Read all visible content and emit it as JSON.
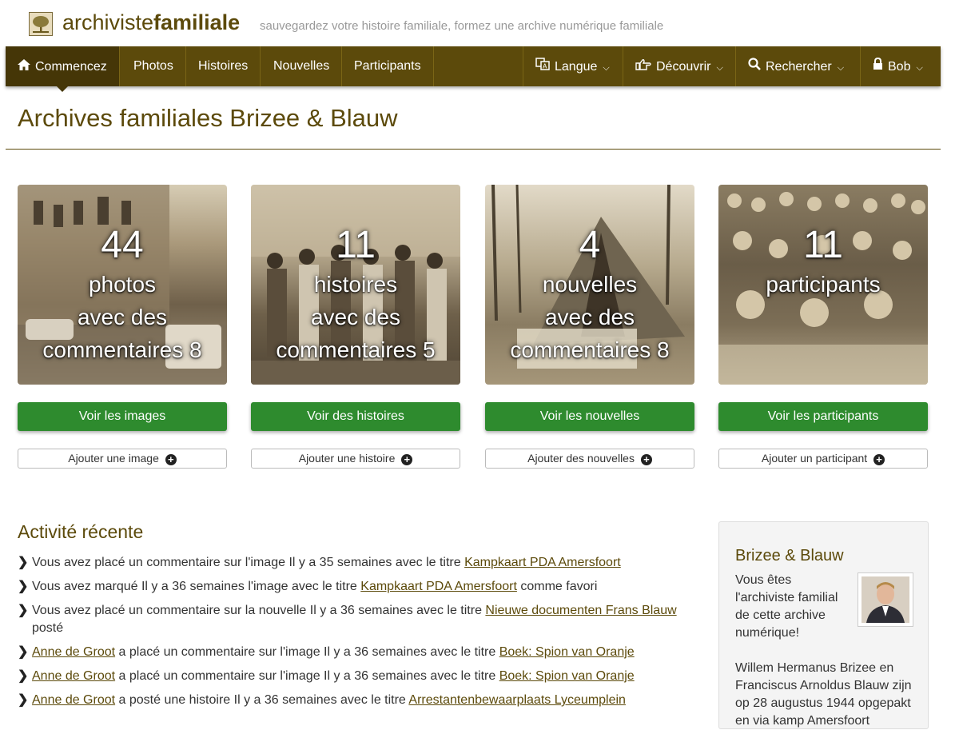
{
  "brand": {
    "name_light": "archiviste",
    "name_bold": "familiale",
    "tagline": "sauvegardez votre histoire familiale, formez une archive numérique familiale",
    "logo_icon": "tree-logo-icon"
  },
  "nav": {
    "items": [
      {
        "label": "Commencez",
        "icon": "home-icon",
        "active": true
      },
      {
        "label": "Photos"
      },
      {
        "label": "Histoires"
      },
      {
        "label": "Nouvelles"
      },
      {
        "label": "Participants"
      }
    ],
    "right": [
      {
        "label": "Langue",
        "icon": "translate-icon"
      },
      {
        "label": "Découvrir",
        "icon": "pointing-hand-icon"
      },
      {
        "label": "Rechercher",
        "icon": "search-icon"
      },
      {
        "label": "Bob",
        "icon": "lock-icon"
      }
    ]
  },
  "page_title": "Archives familiales Brizee & Blauw",
  "cards": [
    {
      "count": "44",
      "line1": "photos",
      "line2": "avec des",
      "line3": "commentaires 8",
      "view_label": "Voir les images",
      "add_label": "Ajouter une image"
    },
    {
      "count": "11",
      "line1": "histoires",
      "line2": "avec des",
      "line3": "commentaires 5",
      "view_label": "Voir des histoires",
      "add_label": "Ajouter une histoire"
    },
    {
      "count": "4",
      "line1": "nouvelles",
      "line2": "avec des",
      "line3": "commentaires 8",
      "view_label": "Voir les nouvelles",
      "add_label": "Ajouter des nouvelles"
    },
    {
      "count": "11",
      "line1": "participants",
      "line2": "",
      "line3": "",
      "view_label": "Voir les participants",
      "add_label": "Ajouter un participant"
    }
  ],
  "activity": {
    "title": "Activité récente",
    "items": [
      {
        "pre_link": "",
        "pre": "Vous avez placé un commentaire sur l'image Il y a 35 semaines avec le titre ",
        "link": "Kampkaart PDA Amersfoort",
        "post": ""
      },
      {
        "pre_link": "",
        "pre": "Vous avez marqué Il y a 36 semaines l'image avec le titre ",
        "link": "Kampkaart PDA Amersfoort",
        "post": " comme favori"
      },
      {
        "pre_link": "",
        "pre": "Vous avez placé un commentaire sur la nouvelle Il y a 36 semaines avec le titre ",
        "link": "Nieuwe documenten Frans Blauw",
        "post": " posté"
      },
      {
        "pre_link": "Anne de Groot",
        "pre": " a placé un commentaire sur l'image Il y a 36 semaines avec le titre ",
        "link": "Boek: Spion van Oranje",
        "post": ""
      },
      {
        "pre_link": "Anne de Groot",
        "pre": " a placé un commentaire sur l'image Il y a 36 semaines avec le titre ",
        "link": "Boek: Spion van Oranje",
        "post": ""
      },
      {
        "pre_link": "Anne de Groot",
        "pre": " a posté une histoire Il y a 36 semaines avec le titre ",
        "link": "Arrestantenbewaarplaats Lyceumplein",
        "post": ""
      }
    ]
  },
  "panel": {
    "title": "Brizee & Blauw",
    "text": "Vous êtes l'archiviste familial de cette archive numérique!",
    "desc": "Willem Hermanus Brizee en Franciscus Arnoldus Blauw zijn op 28 augustus 1944 opgepakt en via kamp Amersfoort"
  },
  "colors": {
    "brand": "#5c4a0b",
    "nav_bg": "#5c4a0b",
    "button_green": "#2e8b2e"
  }
}
